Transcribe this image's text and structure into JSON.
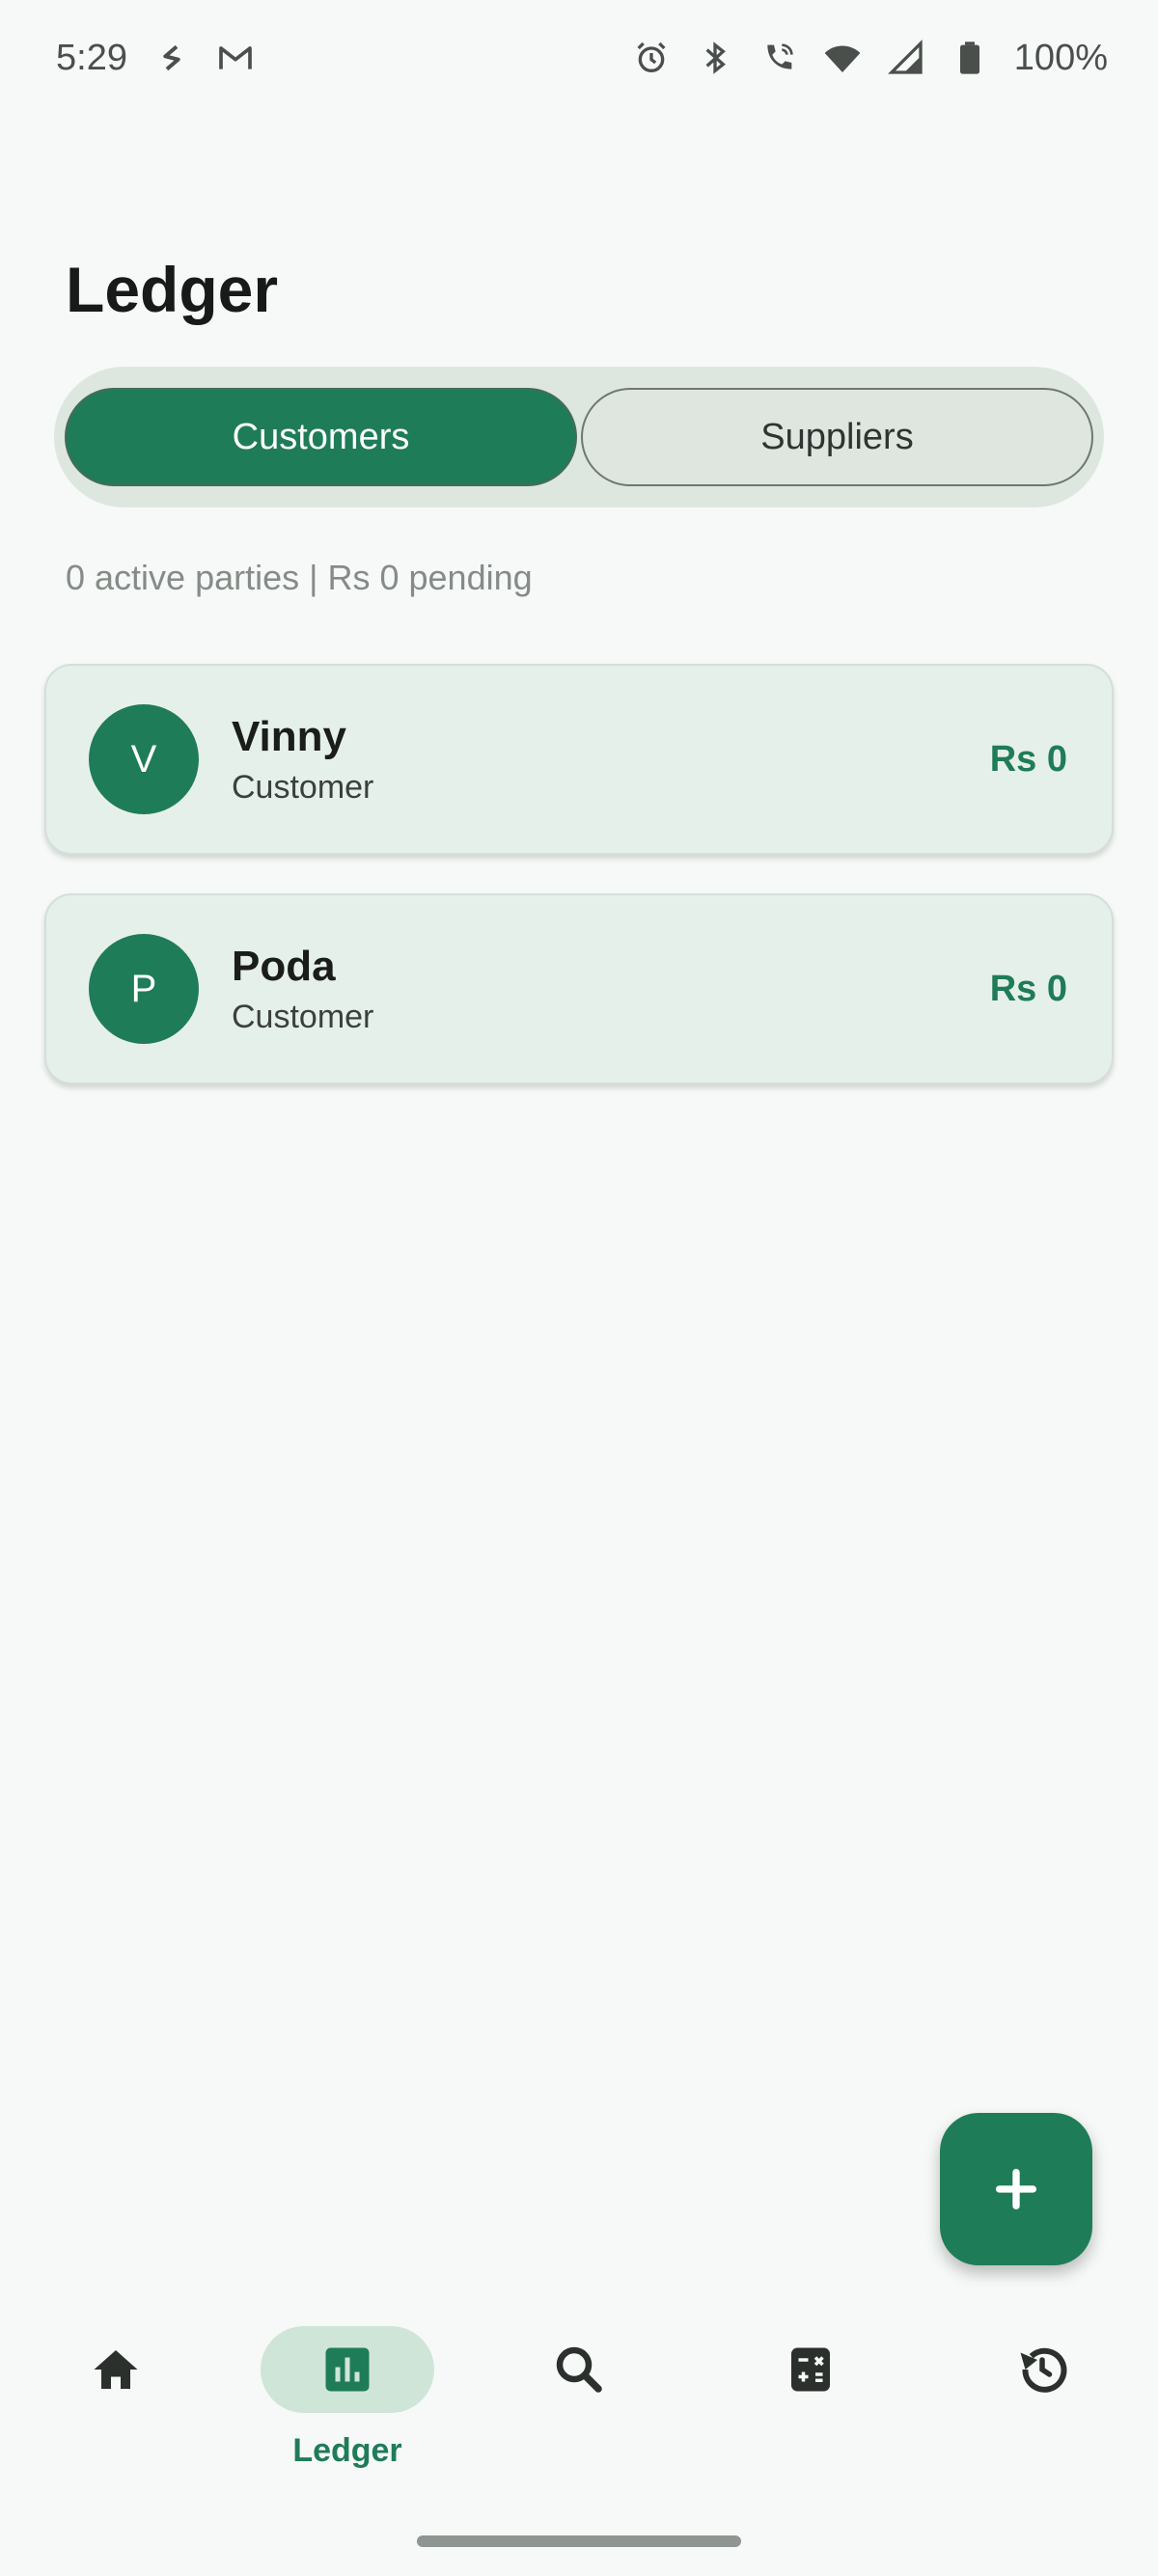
{
  "status_bar": {
    "time": "5:29",
    "battery": "100%",
    "left_icons": [
      "s-app-icon",
      "gmail-icon"
    ],
    "right_icons": [
      "alarm-icon",
      "bluetooth-icon",
      "wifi-calling-icon",
      "wifi-icon",
      "signal-icon",
      "battery-icon"
    ]
  },
  "header": {
    "title": "Ledger"
  },
  "tabs": [
    {
      "label": "Customers",
      "active": true
    },
    {
      "label": "Suppliers",
      "active": false
    }
  ],
  "summary": "0 active parties | Rs 0 pending",
  "parties": [
    {
      "initial": "V",
      "name": "Vinny",
      "type": "Customer",
      "amount": "Rs 0"
    },
    {
      "initial": "P",
      "name": "Poda",
      "type": "Customer",
      "amount": "Rs 0"
    }
  ],
  "fab": {
    "icon": "plus-icon"
  },
  "bottom_nav": {
    "items": [
      {
        "icon": "home-icon",
        "label": "",
        "active": false
      },
      {
        "icon": "bar-chart-icon",
        "label": "Ledger",
        "active": true
      },
      {
        "icon": "search-icon",
        "label": "",
        "active": false
      },
      {
        "icon": "calculator-icon",
        "label": "",
        "active": false
      },
      {
        "icon": "history-icon",
        "label": "",
        "active": false
      }
    ]
  },
  "colors": {
    "primary": "#1f7c58",
    "background": "#f6f9f7",
    "card": "#e6f0ea",
    "segment_track": "#dde7e0",
    "nav_active_pill": "#cfe5d8"
  }
}
